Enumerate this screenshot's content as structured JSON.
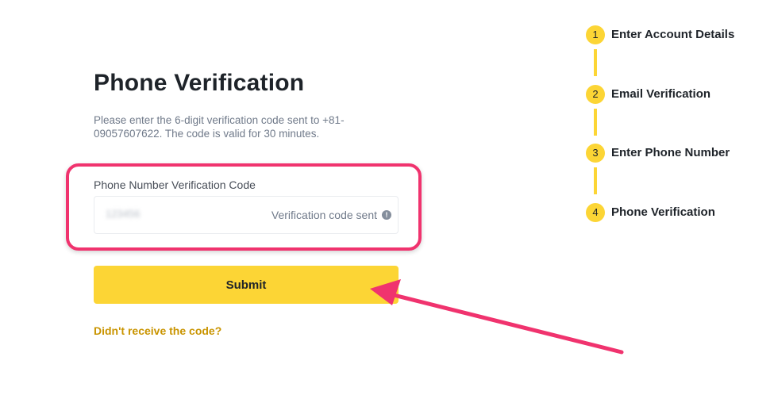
{
  "heading": "Phone Verification",
  "description": "Please enter the 6-digit verification code sent to +81-09057607622. The code is valid for 30 minutes.",
  "field": {
    "label": "Phone Number Verification Code",
    "value": "123456",
    "status": "Verification code sent",
    "status_icon": "info-icon"
  },
  "submit_label": "Submit",
  "resend_link": "Didn't receive the code?",
  "steps": [
    {
      "number": "1",
      "label": "Enter Account Details"
    },
    {
      "number": "2",
      "label": "Email Verification"
    },
    {
      "number": "3",
      "label": "Enter Phone Number"
    },
    {
      "number": "4",
      "label": "Phone Verification"
    }
  ],
  "colors": {
    "accent": "#fcd535",
    "link": "#c99400",
    "annotation": "#f0336e"
  }
}
